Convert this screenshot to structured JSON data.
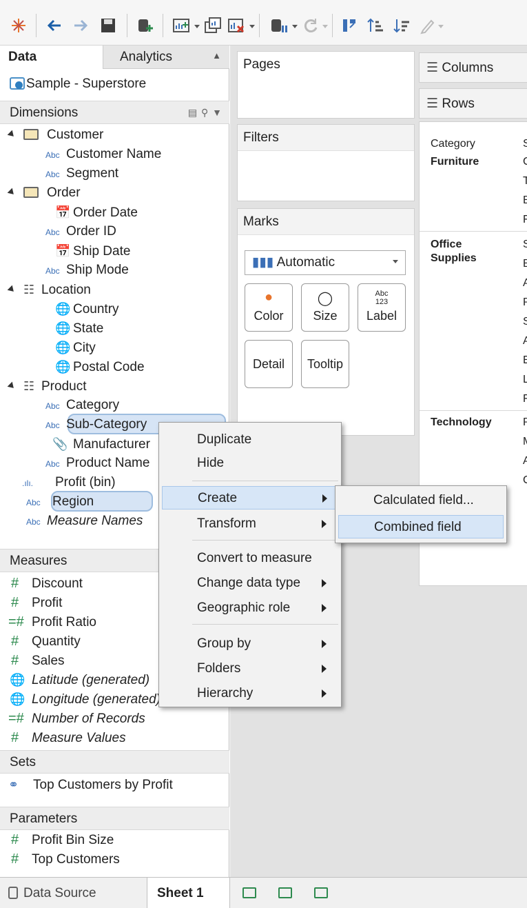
{
  "pane_tabs": {
    "data": "Data",
    "analytics": "Analytics"
  },
  "datasource": "Sample - Superstore",
  "dimensions": {
    "header": "Dimensions",
    "groups": [
      {
        "name": "Customer",
        "fields": [
          {
            "icon": "Abc",
            "label": "Customer Name"
          },
          {
            "icon": "Abc",
            "label": "Segment"
          }
        ]
      },
      {
        "name": "Order",
        "fields": [
          {
            "icon": "calendar",
            "label": "Order Date"
          },
          {
            "icon": "Abc",
            "label": "Order ID"
          },
          {
            "icon": "calendar",
            "label": "Ship Date"
          },
          {
            "icon": "Abc",
            "label": "Ship Mode"
          }
        ]
      },
      {
        "name": "Location",
        "fields": [
          {
            "icon": "globe",
            "label": "Country"
          },
          {
            "icon": "globe",
            "label": "State"
          },
          {
            "icon": "globe",
            "label": "City"
          },
          {
            "icon": "globe",
            "label": "Postal Code"
          }
        ]
      },
      {
        "name": "Product",
        "fields": [
          {
            "icon": "Abc",
            "label": "Category"
          },
          {
            "icon": "Abc",
            "label": "Sub-Category"
          },
          {
            "icon": "paperclip",
            "label": "Manufacturer"
          },
          {
            "icon": "Abc",
            "label": "Product Name"
          }
        ]
      }
    ],
    "loose": [
      {
        "icon": "bin",
        "label": "Profit (bin)"
      },
      {
        "icon": "Abc",
        "label": "Region"
      },
      {
        "icon": "Abc",
        "label": "Measure Names"
      }
    ]
  },
  "measures": {
    "header": "Measures",
    "fields": [
      "Discount",
      "Profit",
      "Profit Ratio",
      "Quantity",
      "Sales",
      "Latitude (generated)",
      "Longitude (generated)",
      "Number of Records",
      "Measure Values"
    ]
  },
  "sets": {
    "header": "Sets",
    "fields": [
      "Top Customers by Profit"
    ]
  },
  "parameters": {
    "header": "Parameters",
    "fields": [
      "Profit Bin Size",
      "Top Customers"
    ]
  },
  "shelves": {
    "pages": "Pages",
    "filters": "Filters",
    "marks": "Marks",
    "marks_type": "Automatic",
    "mark_buttons": [
      "Color",
      "Size",
      "Label",
      "Detail",
      "Tooltip"
    ],
    "label_icon_text": "Abc\n123",
    "columns": "Columns",
    "rows": "Rows"
  },
  "viz": {
    "header_category": "Category",
    "header_sub": "S",
    "categories": [
      "Furniture",
      "Office Supplies",
      "Technology"
    ],
    "sub_initials": {
      "furniture": [
        "C",
        "T",
        "B",
        "F"
      ],
      "office": [
        "S",
        "B",
        "A",
        "P",
        "S",
        "A",
        "E",
        "L",
        "F"
      ],
      "technology": [
        "P",
        "M",
        "A",
        "C"
      ]
    }
  },
  "context_menu": {
    "items": [
      "Duplicate",
      "Hide",
      "Create",
      "Transform",
      "Convert to measure",
      "Change data type",
      "Geographic role",
      "Group by",
      "Folders",
      "Hierarchy"
    ],
    "highlighted": "Create"
  },
  "submenu": {
    "items": [
      "Calculated field...",
      "Combined field"
    ],
    "highlighted": "Combined field"
  },
  "bottom_tabs": {
    "data_source": "Data Source",
    "sheet": "Sheet 1"
  },
  "colors": {
    "selection": "#d6e4f5",
    "dimension_icon": "#3b6fb6",
    "measure_icon": "#2d8a4e",
    "menu_bg": "#f2f2f2"
  }
}
